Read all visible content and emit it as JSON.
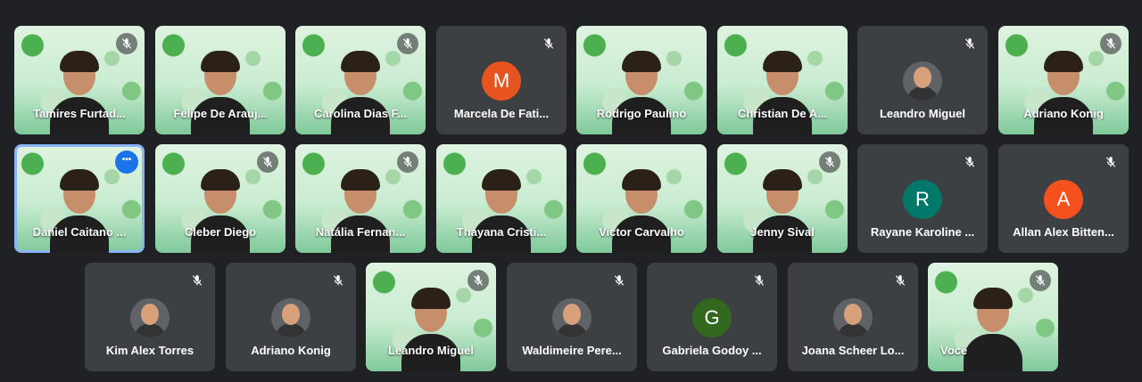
{
  "participants": [
    {
      "name": "Tamires Furtad...",
      "type": "video",
      "muted": true
    },
    {
      "name": "Felipe De Arauj...",
      "type": "video",
      "muted": false
    },
    {
      "name": "Carolina Dias F...",
      "type": "video",
      "muted": true
    },
    {
      "name": "Marcela De Fati...",
      "type": "initial",
      "initial": "M",
      "color": "#e8541f",
      "muted": true
    },
    {
      "name": "Rodrigo Paulino",
      "type": "video",
      "muted": false
    },
    {
      "name": "Christian De A...",
      "type": "video",
      "muted": false
    },
    {
      "name": "Leandro Miguel",
      "type": "photo",
      "muted": true
    },
    {
      "name": "Adriano Konig",
      "type": "video",
      "muted": true
    },
    {
      "name": "Daniel Caitano ...",
      "type": "video",
      "muted": false,
      "active": true,
      "more_icon": "more-options-icon"
    },
    {
      "name": "Cleber Diego",
      "type": "video",
      "muted": true
    },
    {
      "name": "Natália Fernan...",
      "type": "video",
      "muted": true
    },
    {
      "name": "Thayana Cristi...",
      "type": "video",
      "muted": false
    },
    {
      "name": "Victor Carvalho",
      "type": "video",
      "muted": false
    },
    {
      "name": "Jenny Sival",
      "type": "video",
      "muted": true
    },
    {
      "name": "Rayane Karoline ...",
      "type": "initial",
      "initial": "R",
      "color": "#00796b",
      "muted": true
    },
    {
      "name": "Allan Alex Bitten...",
      "type": "initial",
      "initial": "A",
      "color": "#f4511e",
      "muted": true
    },
    {
      "name": "Kim Alex Torres",
      "type": "photo",
      "muted": true
    },
    {
      "name": "Adriano Konig",
      "type": "photo",
      "muted": true
    },
    {
      "name": "Leandro Miguel",
      "type": "video",
      "muted": true
    },
    {
      "name": "Waldimeire Pere...",
      "type": "photo",
      "muted": true
    },
    {
      "name": "Gabriela Godoy ...",
      "type": "initial",
      "initial": "G",
      "color": "#33691e",
      "muted": true
    },
    {
      "name": "Joana Scheer Lo...",
      "type": "photo",
      "muted": true
    },
    {
      "name": "Você",
      "type": "video",
      "muted": true
    }
  ]
}
